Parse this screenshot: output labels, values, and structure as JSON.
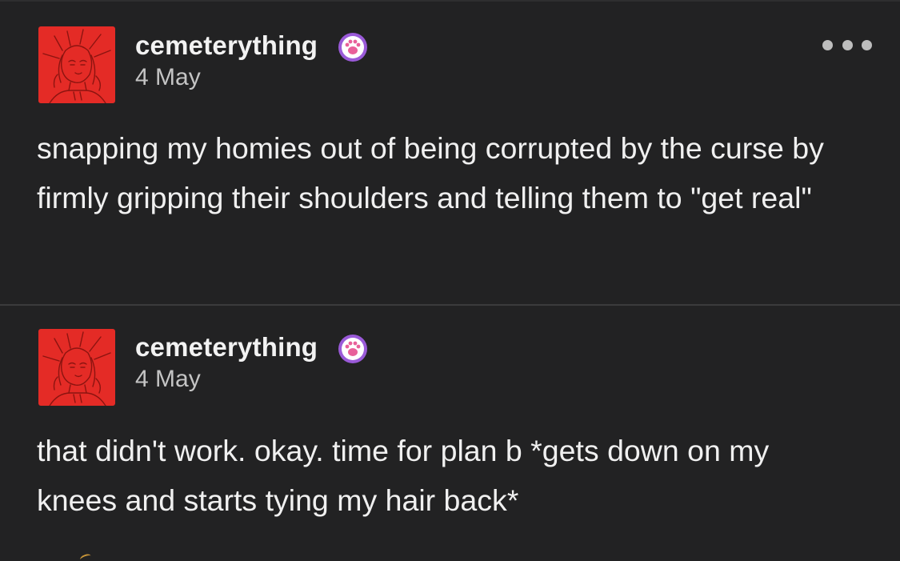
{
  "theme": {
    "background": "#222223",
    "text": "#f0f0f0",
    "muted": "#c4c4c4",
    "avatar_bg": "#e42b26",
    "badge_bg": "#9a5ad8"
  },
  "header": {
    "more_icon": "ellipsis-horizontal-icon"
  },
  "posts": [
    {
      "username": "cemeterything",
      "badge_icon": "paw-badge-icon",
      "date": "4 May",
      "body": "snapping my homies out of being corrupted by the curse by firmly gripping their shoulders and telling them to \"get real\""
    },
    {
      "username": "cemeterything",
      "badge_icon": "paw-badge-icon",
      "date": "4 May",
      "body": "that didn't work. okay. time for plan b *gets down on my knees and starts tying my hair back*"
    }
  ]
}
